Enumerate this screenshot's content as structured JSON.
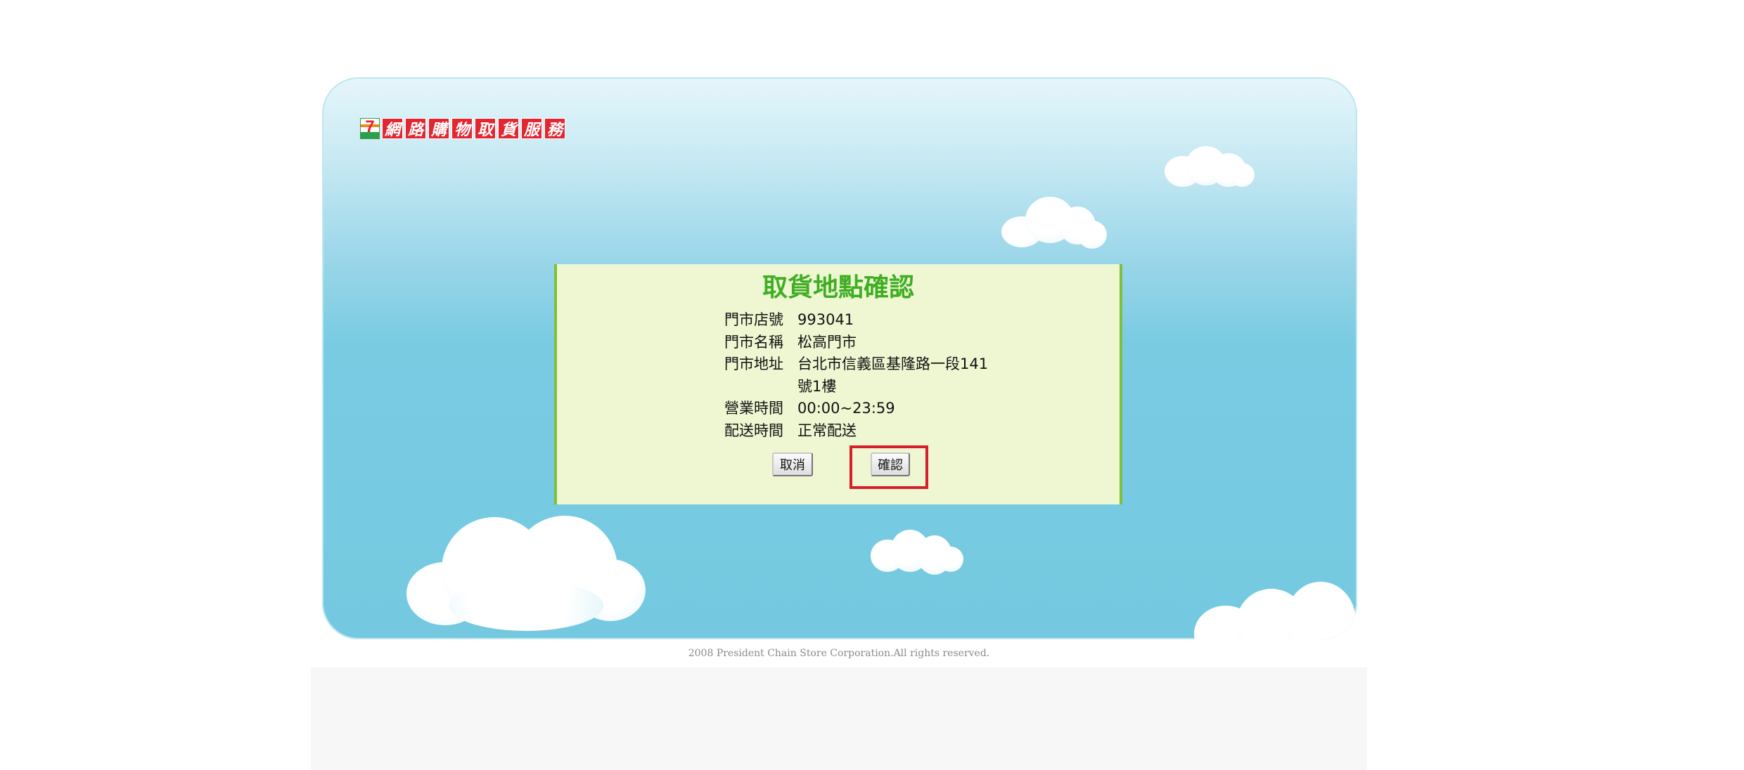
{
  "logo": {
    "seven_mark": "7",
    "title_chars": [
      "網",
      "路",
      "購",
      "物",
      "取",
      "貨",
      "服",
      "務"
    ]
  },
  "dialog": {
    "title": "取貨地點確認",
    "rows": [
      {
        "label": "門市店號",
        "value": "993041"
      },
      {
        "label": "門市名稱",
        "value": "松高門市"
      },
      {
        "label": "門市地址",
        "value": "台北市信義區基隆路一段141號1樓"
      },
      {
        "label": "營業時間",
        "value": "00:00~23:59"
      },
      {
        "label": "配送時間",
        "value": "正常配送"
      }
    ],
    "cancel_label": "取消",
    "confirm_label": "確認"
  },
  "footer": {
    "copyright": "2008 President Chain Store Corporation.All rights reserved."
  },
  "colors": {
    "sky": "#74c9e0",
    "panel_bg": "#eef7d2",
    "panel_border": "#7ec03a",
    "title_green": "#3fae23",
    "logo_red": "#e3262f",
    "highlight_red": "#d5202a"
  }
}
